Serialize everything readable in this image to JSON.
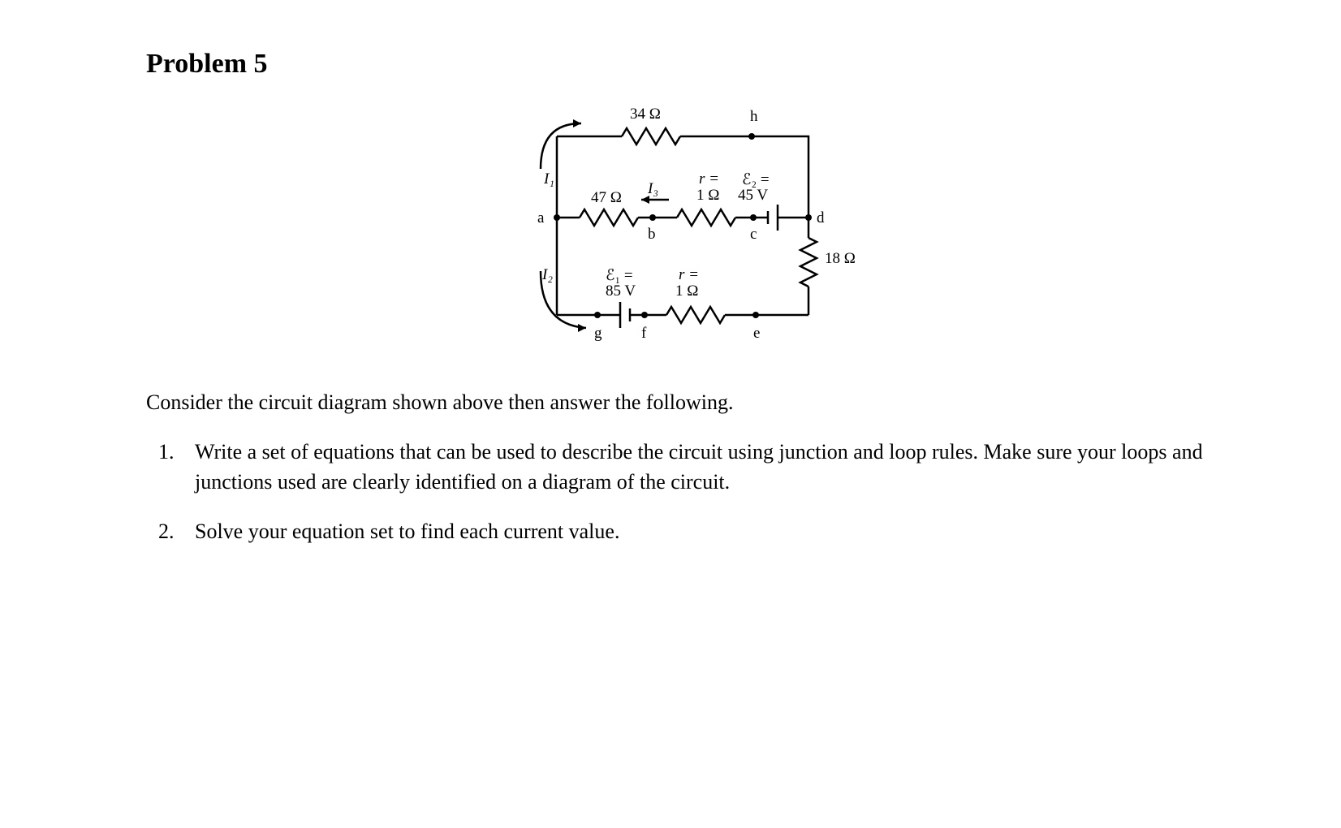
{
  "heading": "Problem 5",
  "diagram": {
    "R_top": "34 Ω",
    "R_ab": "47 Ω",
    "R_bc_r": "r =",
    "R_bc_val": "1 Ω",
    "E2_top": "ℰ₂ =",
    "E2_val": "45 V",
    "R_de": "18 Ω",
    "E1_top": "ℰ₁ =",
    "E1_val": "85 V",
    "R_fe_r": "r =",
    "R_fe_val": "1 Ω",
    "I1": "I₁",
    "I2": "I₂",
    "I3": "I₃",
    "node_a": "a",
    "node_b": "b",
    "node_c": "c",
    "node_d": "d",
    "node_e": "e",
    "node_f": "f",
    "node_g": "g",
    "node_h": "h"
  },
  "intro": "Consider the circuit diagram shown above then answer the following.",
  "questions": [
    "Write a set of equations that can be used to describe the circuit using junction and loop rules. Make sure your loops and junctions used are clearly identified on a diagram of the circuit.",
    "Solve your equation set to find each current value."
  ]
}
